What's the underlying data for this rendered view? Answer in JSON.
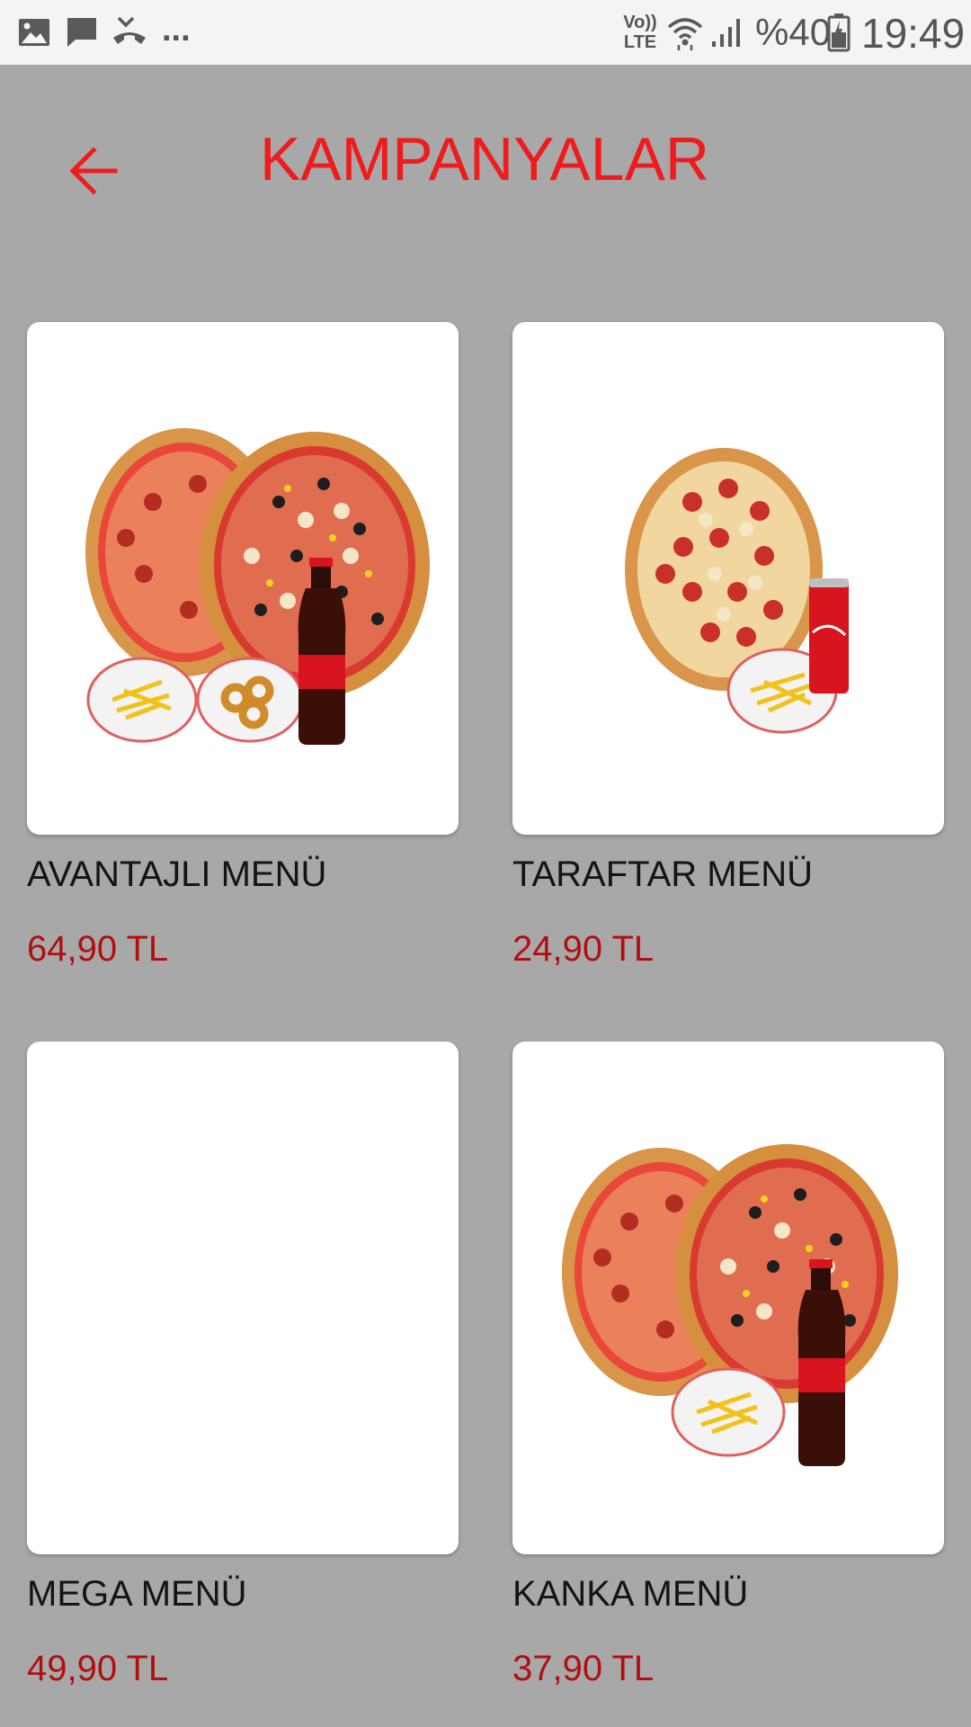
{
  "status_bar": {
    "icons": [
      "image-icon",
      "message-icon",
      "missed-call-icon",
      "more-notifications-icon",
      "volte-icon",
      "wifi-icon",
      "signal-icon",
      "battery-icon"
    ],
    "more": "...",
    "volte_top": "Vo))",
    "volte_bottom": "LTE",
    "battery": "%40",
    "time": "19:49"
  },
  "header": {
    "title": "KAMPANYALAR",
    "back_icon": "arrow-left-icon",
    "accent_color": "#ee1c1c"
  },
  "products": [
    {
      "name": "AVANTAJLI MENÜ",
      "price": "64,90 TL",
      "image": "two-pizzas-fries-rings-cola"
    },
    {
      "name": "TARAFTAR MENÜ",
      "price": "24,90 TL",
      "image": "pizza-fries-can"
    },
    {
      "name": "MEGA MENÜ",
      "price": "49,90 TL",
      "image": ""
    },
    {
      "name": "KANKA MENÜ",
      "price": "37,90 TL",
      "image": "two-pizzas-fries-cola"
    }
  ],
  "colors": {
    "background": "#a8a8a8",
    "price": "#b10f0f"
  }
}
